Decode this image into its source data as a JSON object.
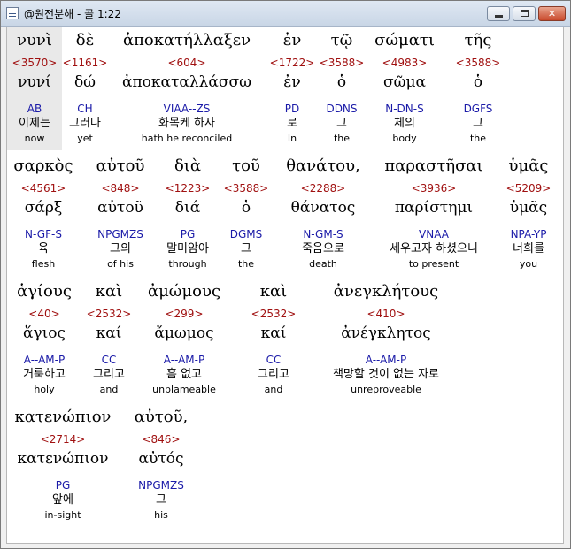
{
  "window": {
    "title": "@원전분해 - 골 1:22",
    "minimize_label": "",
    "maximize_label": "",
    "close_label": "✕"
  },
  "rows": [
    {
      "words": [
        {
          "greek": "νυνὶ",
          "strong": "<3570>",
          "lemma": "νυνί",
          "morph": "AB",
          "korean": "이제는",
          "english": "now"
        },
        {
          "greek": "δὲ",
          "strong": "<1161>",
          "lemma": "δώ",
          "morph": "CH",
          "korean": "그러나",
          "english": "yet"
        },
        {
          "greek": "ἀποκατήλλαξεν",
          "strong": "<604>",
          "lemma": "ἀποκαταλλάσσω",
          "morph": "VIAA--ZS",
          "korean": "화목케 하사",
          "english": "hath he reconciled"
        },
        {
          "greek": "ἐν",
          "strong": "<1722>",
          "lemma": "ἐν",
          "morph": "PD",
          "korean": "로",
          "english": "In"
        },
        {
          "greek": "τῷ",
          "strong": "<3588>",
          "lemma": "ὁ",
          "morph": "DDNS",
          "korean": "그",
          "english": "the"
        },
        {
          "greek": "σώματι",
          "strong": "<4983>",
          "lemma": "σῶμα",
          "morph": "N-DN-S",
          "korean": "체의",
          "english": "body"
        },
        {
          "greek": "τῆς",
          "strong": "<3588>",
          "lemma": "ὁ",
          "morph": "DGFS",
          "korean": "그",
          "english": "the"
        }
      ]
    },
    {
      "words": [
        {
          "greek": "σαρκὸς",
          "strong": "<4561>",
          "lemma": "σάρξ",
          "morph": "N-GF-S",
          "korean": "육",
          "english": "flesh"
        },
        {
          "greek": "αὐτοῦ",
          "strong": "<848>",
          "lemma": "αὐτοῦ",
          "morph": "NPGMZS",
          "korean": "그의",
          "english": "of his"
        },
        {
          "greek": "διὰ",
          "strong": "<1223>",
          "lemma": "διά",
          "morph": "PG",
          "korean": "말미암아",
          "english": "through"
        },
        {
          "greek": "τοῦ",
          "strong": "<3588>",
          "lemma": "ὁ",
          "morph": "DGMS",
          "korean": "그",
          "english": "the"
        },
        {
          "greek": "θανάτου,",
          "strong": "<2288>",
          "lemma": "θάνατος",
          "morph": "N-GM-S",
          "korean": "죽음으로",
          "english": "death"
        },
        {
          "greek": "παραστῆσαι",
          "strong": "<3936>",
          "lemma": "παρίστημι",
          "morph": "VNAA",
          "korean": "세우고자 하셨으니",
          "english": "to present"
        },
        {
          "greek": "ὑμᾶς",
          "strong": "<5209>",
          "lemma": "ὑμᾶς",
          "morph": "NPA-YP",
          "korean": "너희를",
          "english": "you"
        }
      ]
    },
    {
      "words": [
        {
          "greek": "ἁγίους",
          "strong": "<40>",
          "lemma": "ἅγιος",
          "morph": "A--AM-P",
          "korean": "거룩하고",
          "english": "holy"
        },
        {
          "greek": "καὶ",
          "strong": "<2532>",
          "lemma": "καί",
          "morph": "CC",
          "korean": "그리고",
          "english": "and"
        },
        {
          "greek": "ἀμώμους",
          "strong": "<299>",
          "lemma": "ἄμωμος",
          "morph": "A--AM-P",
          "korean": "흠 없고",
          "english": "unblameable"
        },
        {
          "greek": "καὶ",
          "strong": "<2532>",
          "lemma": "καί",
          "morph": "CC",
          "korean": "그리고",
          "english": "and"
        },
        {
          "greek": "ἀνεγκλήτους",
          "strong": "<410>",
          "lemma": "ἀνέγκλητος",
          "morph": "A--AM-P",
          "korean": "책망할 것이 없는 자로",
          "english": "unreproveable"
        }
      ]
    },
    {
      "words": [
        {
          "greek": "κατενώπιον",
          "strong": "<2714>",
          "lemma": "κατενώπιον",
          "morph": "PG",
          "korean": "앞에",
          "english": "in-sight"
        },
        {
          "greek": "αὐτοῦ,",
          "strong": "<846>",
          "lemma": "αὐτός",
          "morph": "NPGMZS",
          "korean": "그",
          "english": "his"
        }
      ]
    }
  ]
}
